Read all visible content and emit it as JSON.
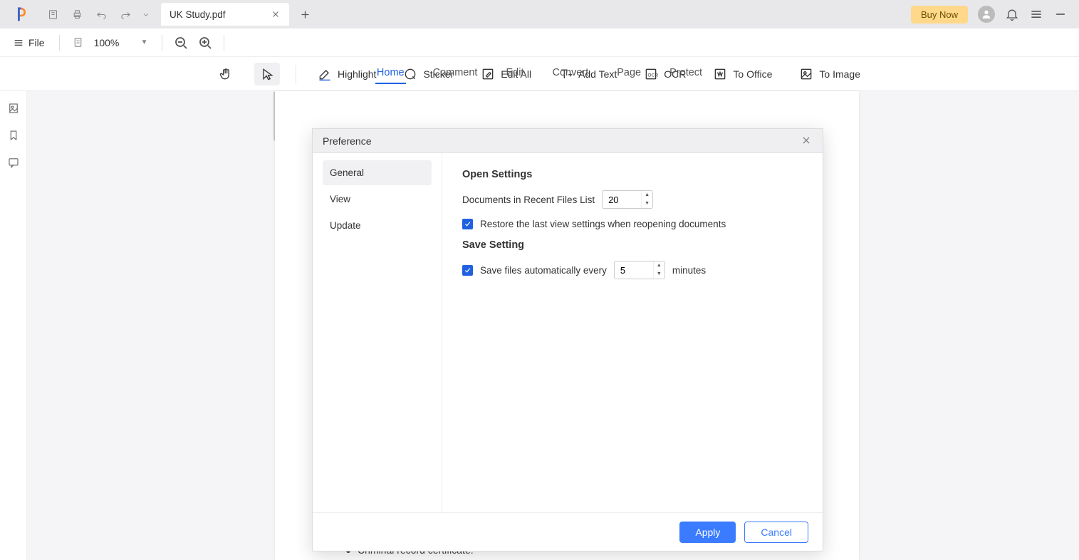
{
  "titlebar": {
    "tab_title": "UK Study.pdf",
    "buy_now": "Buy Now"
  },
  "filestrip": {
    "file_label": "File",
    "zoom": "100%"
  },
  "menubar": [
    "Home",
    "Comment",
    "Edit",
    "Convert",
    "Page",
    "Protect"
  ],
  "toolbar": {
    "highlight": "Highlight",
    "sticker": "Sticker",
    "edit_all": "Edit All",
    "add_text": "Add Text",
    "ocr": "OCR",
    "to_office": "To Office",
    "to_image": "To Image"
  },
  "hidden_page_text": "Criminal record certificate.",
  "dialog": {
    "title": "Preference",
    "side": {
      "general": "General",
      "view": "View",
      "update": "Update"
    },
    "open_settings_title": "Open Settings",
    "recent_label": "Documents in Recent Files List",
    "recent_value": "20",
    "restore_label": "Restore the last view settings when reopening documents",
    "save_settings_title": "Save Setting",
    "autosave_prefix": "Save files automatically every",
    "autosave_value": "5",
    "autosave_suffix": "minutes",
    "apply": "Apply",
    "cancel": "Cancel"
  }
}
